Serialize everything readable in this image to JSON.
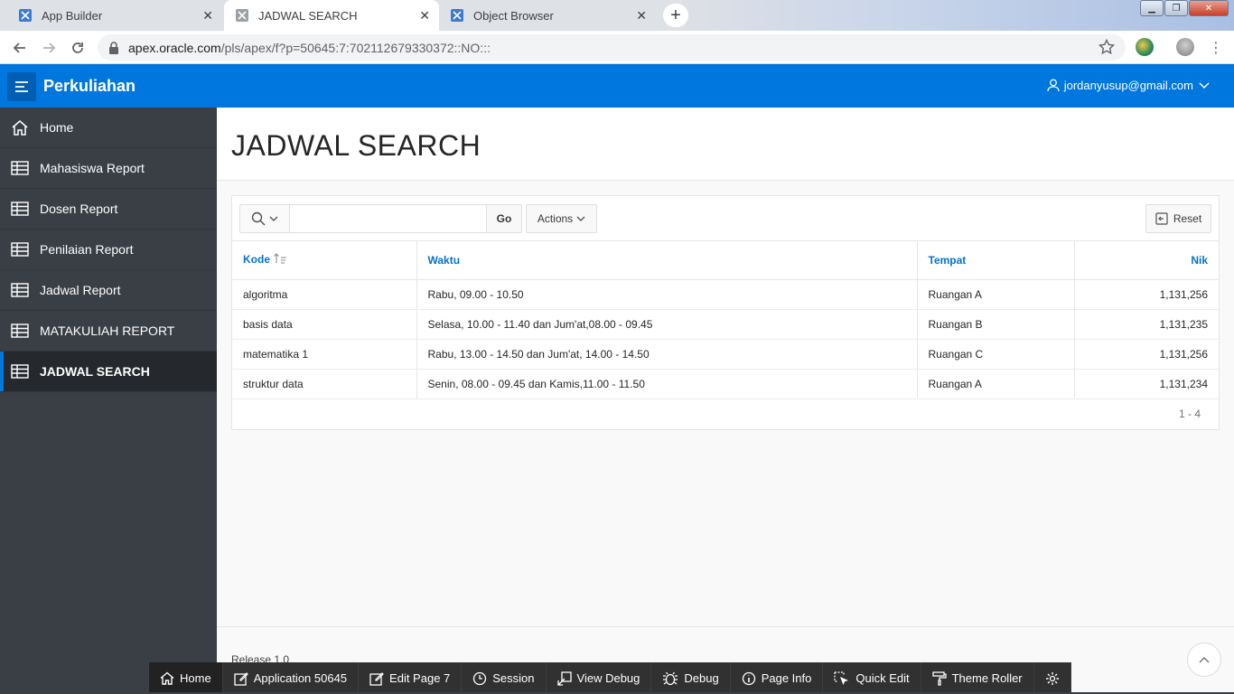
{
  "browser": {
    "tabs": [
      {
        "title": "App Builder",
        "active": false
      },
      {
        "title": "JADWAL SEARCH",
        "active": true
      },
      {
        "title": "Object Browser",
        "active": false
      }
    ],
    "url_domain": "apex.oracle.com",
    "url_path": "/pls/apex/f?p=50645:7:702112679330372::NO:::"
  },
  "header": {
    "app_title": "Perkuliahan",
    "user": "jordanyusup@gmail.com"
  },
  "sidebar": {
    "items": [
      {
        "label": "Home",
        "icon": "home-icon"
      },
      {
        "label": "Mahasiswa Report",
        "icon": "table-icon"
      },
      {
        "label": "Dosen Report",
        "icon": "table-icon"
      },
      {
        "label": "Penilaian Report",
        "icon": "table-icon"
      },
      {
        "label": "Jadwal Report",
        "icon": "table-icon"
      },
      {
        "label": "MATAKULIAH REPORT",
        "icon": "table-icon"
      },
      {
        "label": "JADWAL SEARCH",
        "icon": "table-icon",
        "active": true
      }
    ]
  },
  "page": {
    "title": "JADWAL SEARCH"
  },
  "report": {
    "search_value": "",
    "go_label": "Go",
    "actions_label": "Actions",
    "reset_label": "Reset",
    "columns": [
      "Kode",
      "Waktu",
      "Tempat",
      "Nik"
    ],
    "rows": [
      [
        "algoritma",
        "Rabu, 09.00 - 10.50",
        "Ruangan A",
        "1,131,256"
      ],
      [
        "basis data",
        "Selasa, 10.00 - 11.40 dan Jum'at,08.00 - 09.45",
        "Ruangan B",
        "1,131,235"
      ],
      [
        "matematika 1",
        "Rabu, 13.00 - 14.50 dan Jum'at, 14.00 - 14.50",
        "Ruangan C",
        "1,131,256"
      ],
      [
        "struktur data",
        "Senin, 08.00 - 09.45 dan Kamis,11.00 - 11.50",
        "Ruangan A",
        "1,131,234"
      ]
    ],
    "pagination": "1 - 4"
  },
  "footer": {
    "release": "Release 1.0"
  },
  "devbar": {
    "items": [
      "Home",
      "Application 50645",
      "Edit Page 7",
      "Session",
      "View Debug",
      "Debug",
      "Page Info",
      "Quick Edit",
      "Theme Roller"
    ]
  },
  "colors": {
    "header_blue": "#0076df",
    "sidebar_bg": "#3a3f45",
    "link_blue": "#0572ce"
  }
}
